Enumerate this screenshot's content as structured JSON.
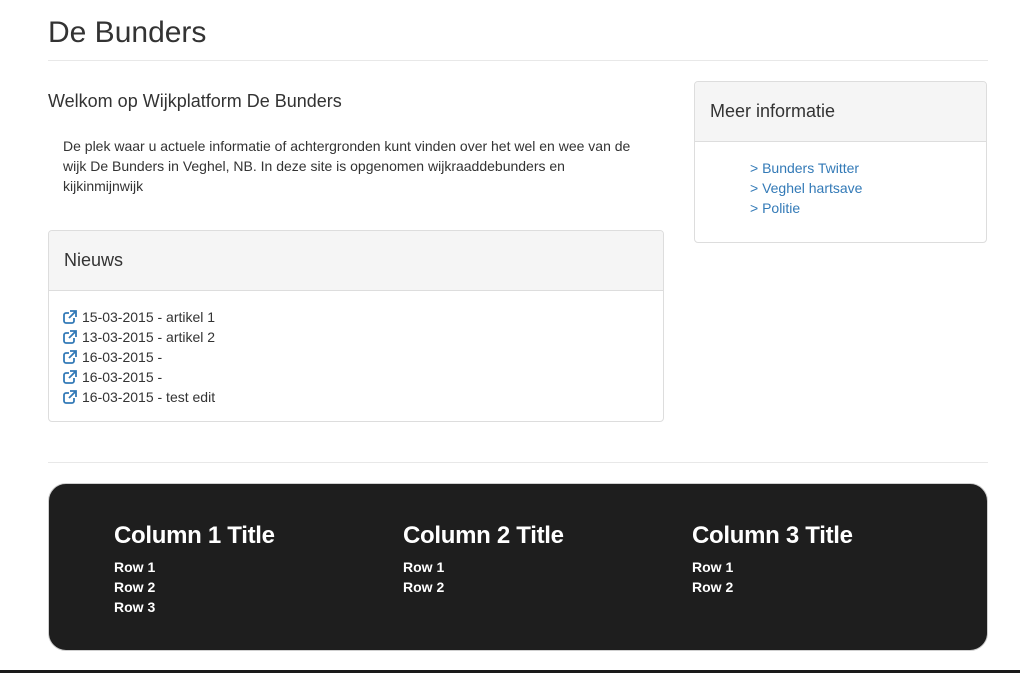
{
  "page": {
    "title": "De Bunders"
  },
  "welcome": {
    "heading": "Welkom op Wijkplatform De Bunders",
    "text_lines": [
      "De plek waar u actuele informatie of achtergronden kunt vinden over het wel en wee van de",
      "wijk De Bunders in Veghel, NB. In deze site is opgenomen wijkraaddebunders en",
      "kijkinmijnwijk"
    ]
  },
  "news": {
    "heading": "Nieuws",
    "icon": "external-link-icon",
    "accent_color": "#337ab7",
    "items": [
      "15-03-2015 - artikel 1",
      "13-03-2015 - artikel 2",
      "16-03-2015 -",
      "16-03-2015 -",
      "16-03-2015 - test edit"
    ]
  },
  "info": {
    "heading": "Meer informatie",
    "links": [
      "> Bunders Twitter",
      "> Veghel hartsave",
      "> Politie"
    ],
    "link_color": "#337ab7"
  },
  "footer": {
    "background": "#1e1e1e",
    "columns": [
      {
        "title": "Column 1 Title",
        "rows": [
          "Row 1",
          "Row 2",
          "Row 3"
        ]
      },
      {
        "title": "Column 2 Title",
        "rows": [
          "Row 1",
          "Row 2"
        ]
      },
      {
        "title": "Column 3 Title",
        "rows": [
          "Row 1",
          "Row 2"
        ]
      }
    ]
  }
}
